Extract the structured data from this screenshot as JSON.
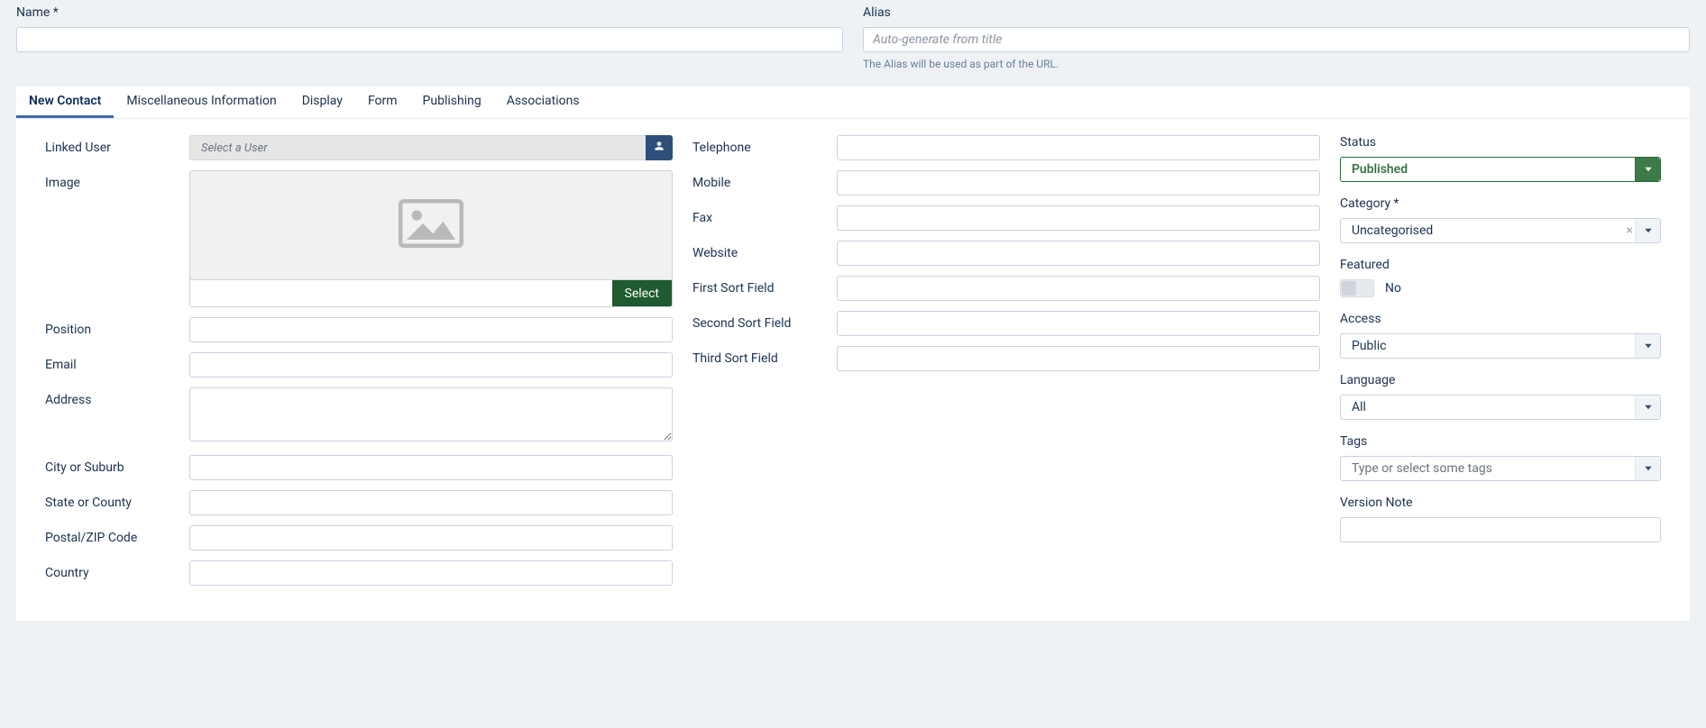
{
  "header": {
    "name_label": "Name *",
    "alias_label": "Alias",
    "alias_placeholder": "Auto-generate from title",
    "alias_hint": "The Alias will be used as part of the URL."
  },
  "tabs": [
    "New Contact",
    "Miscellaneous Information",
    "Display",
    "Form",
    "Publishing",
    "Associations"
  ],
  "col1": {
    "linked_user_label": "Linked User",
    "linked_user_placeholder": "Select a User",
    "image_label": "Image",
    "image_select": "Select",
    "position_label": "Position",
    "email_label": "Email",
    "address_label": "Address",
    "city_label": "City or Suburb",
    "state_label": "State or County",
    "postal_label": "Postal/ZIP Code",
    "country_label": "Country"
  },
  "col2": {
    "telephone_label": "Telephone",
    "mobile_label": "Mobile",
    "fax_label": "Fax",
    "website_label": "Website",
    "first_sort_label": "First Sort Field",
    "second_sort_label": "Second Sort Field",
    "third_sort_label": "Third Sort Field"
  },
  "side": {
    "status_label": "Status",
    "status_value": "Published",
    "category_label": "Category *",
    "category_value": "Uncategorised",
    "featured_label": "Featured",
    "featured_value": "No",
    "access_label": "Access",
    "access_value": "Public",
    "language_label": "Language",
    "language_value": "All",
    "tags_label": "Tags",
    "tags_placeholder": "Type or select some tags",
    "version_label": "Version Note"
  }
}
